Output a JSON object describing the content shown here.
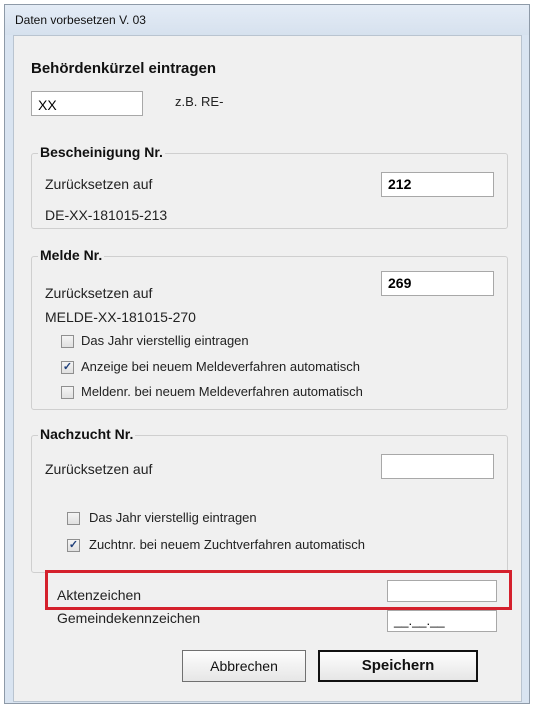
{
  "window": {
    "title": "Daten vorbesetzen V. 03"
  },
  "authority": {
    "heading": "Behördenkürzel eintragen",
    "value": "XX",
    "example": "z.B. RE-"
  },
  "certificate": {
    "group_title": "Bescheinigung Nr.",
    "reset_label": "Zurücksetzen auf",
    "reset_value": "212",
    "preview": "DE-XX-181015-213"
  },
  "report": {
    "group_title": "Melde Nr.",
    "reset_label": "Zurücksetzen auf",
    "reset_value": "269",
    "preview": "MELDE-XX-181015-270",
    "checkboxes": [
      {
        "label": "Das Jahr vierstellig eintragen",
        "checked": false
      },
      {
        "label": "Anzeige bei neuem Meldeverfahren automatisch",
        "checked": true
      },
      {
        "label": "Meldenr. bei neuem Meldeverfahren automatisch",
        "checked": false
      }
    ]
  },
  "breeding": {
    "group_title": "Nachzucht Nr.",
    "reset_label": "Zurücksetzen auf",
    "reset_value": "",
    "checkboxes": [
      {
        "label": "Das Jahr vierstellig eintragen",
        "checked": false
      },
      {
        "label": "Zuchtnr. bei neuem Zuchtverfahren automatisch",
        "checked": true
      }
    ]
  },
  "file_reference": {
    "label": "Aktenzeichen",
    "value": ""
  },
  "municipality": {
    "label": "Gemeindekennzeichen",
    "value": "__.__.__"
  },
  "buttons": {
    "cancel": "Abbrechen",
    "save": "Speichern"
  },
  "colors": {
    "highlight": "#d4202c",
    "check": "#1f3f7a"
  }
}
